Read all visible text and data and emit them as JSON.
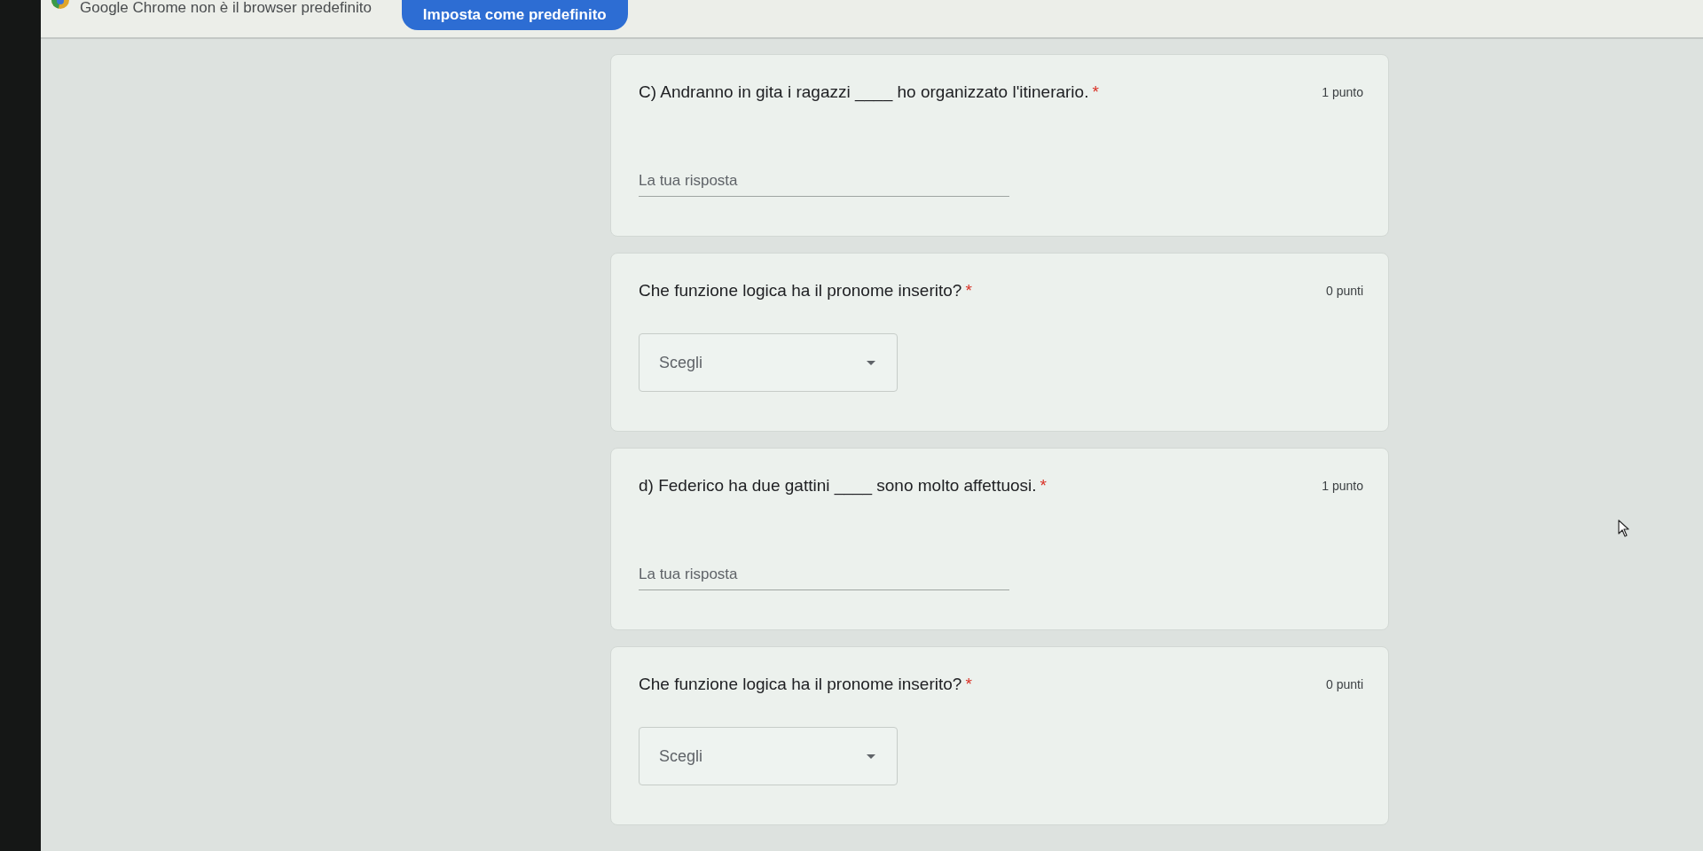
{
  "infobar": {
    "message": "Google Chrome non è il browser predefinito",
    "button": "Imposta come predefinito"
  },
  "questions": [
    {
      "kind": "short_answer",
      "title": "C) Andranno in gita i ragazzi ____ ho organizzato l'itinerario.",
      "required_mark": "*",
      "points": "1 punto",
      "placeholder": "La tua risposta"
    },
    {
      "kind": "dropdown",
      "title": "Che funzione logica ha il pronome inserito?",
      "required_mark": "*",
      "points": "0 punti",
      "placeholder": "Scegli"
    },
    {
      "kind": "short_answer",
      "title": "d) Federico ha due gattini ____ sono molto affettuosi.",
      "required_mark": "*",
      "points": "1 punto",
      "placeholder": "La tua risposta"
    },
    {
      "kind": "dropdown",
      "title": "Che funzione logica ha il pronome inserito?",
      "required_mark": "*",
      "points": "0 punti",
      "placeholder": "Scegli"
    }
  ]
}
